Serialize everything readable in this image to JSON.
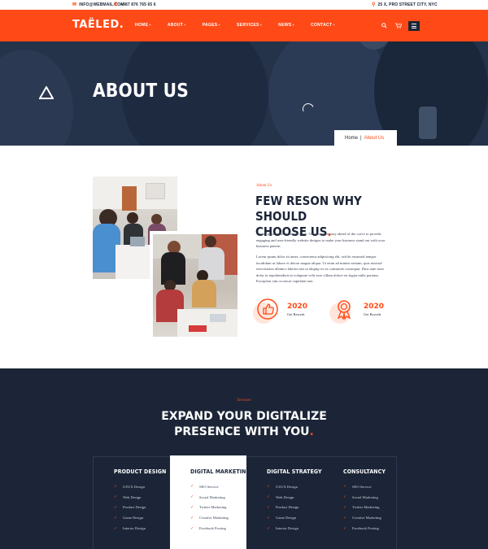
{
  "topbar": {
    "email": "INFO@WEBMAIL.COM",
    "phone": "+987 876 765 65 6",
    "address": "25 X, PRO STREET CITY, NYC"
  },
  "nav": {
    "logo": "TAËLED.",
    "menu": [
      "HOME",
      "ABOUT",
      "PAGES",
      "SERVICES",
      "NEWS",
      "CONTACT"
    ]
  },
  "hero": {
    "title": "ABOUT US",
    "breadcrumb_home": "Home",
    "breadcrumb_sep": "|",
    "breadcrumb_current": "About Us"
  },
  "about": {
    "subtitle": "About Us",
    "title_line1": "FEW RESON WHY SHOULD",
    "title_line2": "CHOOSE US",
    "title_dot": ".",
    "para1": "We are passionate about our work. Our designers stay ahead of the curve to provide engaging and user-friendly website designs to make your business stand out with your business pattern.",
    "para2": "Lorem ipsum dolor sit amet, consectetur adipisicing elit, sed do eiusmod tempor incididunt ut labore et dolore magna aliqua. Ut enim ad minim veniam, quis nostrud exercitation ullamco laboris nisi ut aliquip ex ea commodo consequat. Duis aute irure dolor in reprehenderit in voluptate velit esse cillum dolore eu fugiat nulla pariatur. Excepteur sint occaecat cupidatat non.",
    "awards": [
      {
        "year": "2020",
        "label": "Get Rewrds",
        "icon": "thumbs-up-icon"
      },
      {
        "year": "2020",
        "label": "Get Rewrds",
        "icon": "medal-icon"
      }
    ]
  },
  "services": {
    "subtitle": "Services",
    "title_line1": "EXPAND YOUR DIGITALIZE",
    "title_line2": "PRESENCE WITH YOU",
    "title_dot": ".",
    "columns": [
      {
        "title": "PRODUCT DESIGN",
        "items": [
          "UI/UX Design",
          "Web Design",
          "Product Design",
          "Game Design",
          "Interior Design"
        ]
      },
      {
        "title": "DIGITAL MARKETING",
        "items": [
          "SEO Service",
          "Social Marketing",
          "Twitter Marketing",
          "Creative Marketing",
          "Facebook Posting"
        ]
      },
      {
        "title": "DIGITAL STRATEGY",
        "items": [
          "UI/UX Design",
          "Web Design",
          "Product Design",
          "Game Design",
          "Interior Design"
        ]
      },
      {
        "title": "CONSULTANCY",
        "items": [
          "SEO Service",
          "Social Marketing",
          "Twitter Marketing",
          "Creative Marketing",
          "Facebook Posting"
        ]
      }
    ]
  },
  "colors": {
    "accent": "#ff4a17",
    "dark": "#1b2537",
    "hero": "#24324a"
  }
}
